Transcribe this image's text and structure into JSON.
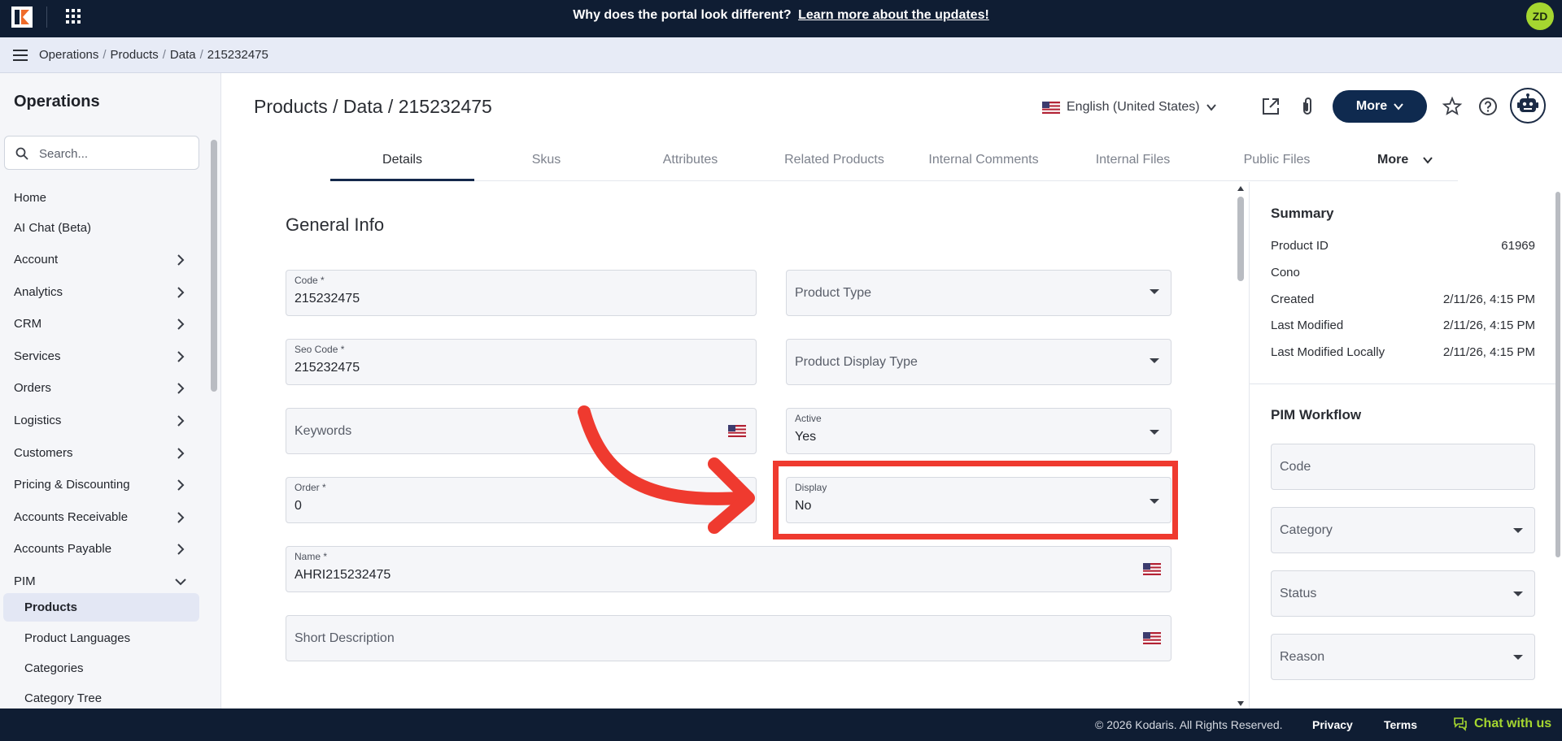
{
  "top_bar": {
    "banner_text": "Why does the portal look different?",
    "banner_link": "Learn more about the updates!",
    "user_initials": "ZD"
  },
  "breadcrumb": [
    "Operations",
    "Products",
    "Data",
    "215232475"
  ],
  "sidebar": {
    "title": "Operations",
    "search_placeholder": "Search...",
    "items": [
      {
        "label": "Home"
      },
      {
        "label": "AI Chat (Beta)"
      },
      {
        "label": "Account"
      },
      {
        "label": "Analytics"
      },
      {
        "label": "CRM"
      },
      {
        "label": "Services"
      },
      {
        "label": "Orders"
      },
      {
        "label": "Logistics"
      },
      {
        "label": "Customers"
      },
      {
        "label": "Pricing & Discounting"
      },
      {
        "label": "Accounts Receivable"
      },
      {
        "label": "Accounts Payable"
      },
      {
        "label": "PIM"
      }
    ],
    "sub_items": [
      {
        "label": "Products",
        "active": true
      },
      {
        "label": "Product Languages"
      },
      {
        "label": "Categories"
      },
      {
        "label": "Category Tree"
      }
    ]
  },
  "header": {
    "title": "Products / Data / 215232475",
    "language": "English (United States)",
    "more_label": "More"
  },
  "tabs": [
    {
      "label": "Details",
      "active": true
    },
    {
      "label": "Skus"
    },
    {
      "label": "Attributes"
    },
    {
      "label": "Related Products"
    },
    {
      "label": "Internal Comments"
    },
    {
      "label": "Internal Files"
    },
    {
      "label": "Public Files"
    },
    {
      "label": "More"
    }
  ],
  "general_info": {
    "title": "General Info",
    "code": {
      "label": "Code *",
      "value": "215232475"
    },
    "product_type": {
      "placeholder": "Product Type"
    },
    "seo_code": {
      "label": "Seo Code *",
      "value": "215232475"
    },
    "product_display_type": {
      "placeholder": "Product Display Type"
    },
    "keywords": {
      "placeholder": "Keywords"
    },
    "active": {
      "label": "Active",
      "value": "Yes"
    },
    "order": {
      "label": "Order *",
      "value": "0"
    },
    "display": {
      "label": "Display",
      "value": "No"
    },
    "name": {
      "label": "Name *",
      "value": "AHRI215232475"
    },
    "short_description": {
      "placeholder": "Short Description"
    }
  },
  "summary": {
    "title": "Summary",
    "rows": [
      {
        "label": "Product ID",
        "value": "61969"
      },
      {
        "label": "Cono",
        "value": ""
      },
      {
        "label": "Created",
        "value": "2/11/26, 4:15 PM"
      },
      {
        "label": "Last Modified",
        "value": "2/11/26, 4:15 PM"
      },
      {
        "label": "Last Modified Locally",
        "value": "2/11/26, 4:15 PM"
      }
    ]
  },
  "pim_workflow": {
    "title": "PIM Workflow",
    "code_placeholder": "Code",
    "category_placeholder": "Category",
    "status_placeholder": "Status",
    "reason_placeholder": "Reason"
  },
  "footer": {
    "copyright": "© 2026 Kodaris. All Rights Reserved.",
    "privacy": "Privacy",
    "terms": "Terms",
    "chat": "Chat with us"
  },
  "colors": {
    "nav_dark": "#0f1d33",
    "accent_button": "#0f2a4f",
    "highlight": "#ef3a2f",
    "chat_green": "#a5d630"
  }
}
